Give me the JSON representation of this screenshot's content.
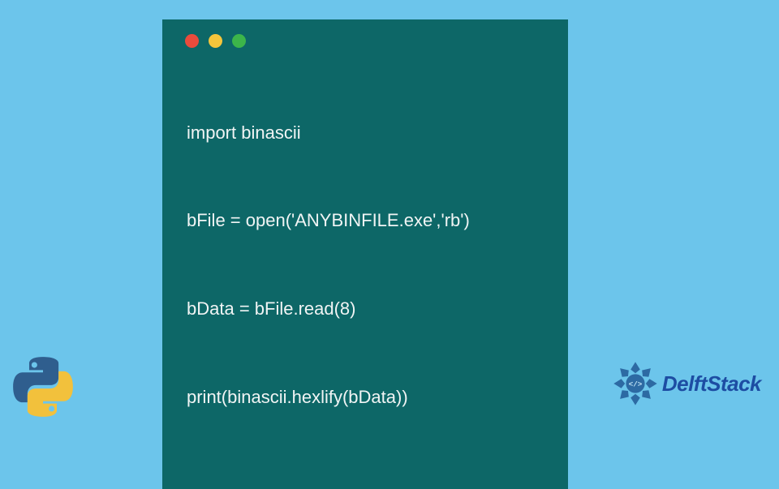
{
  "code": {
    "lines": [
      "import binascii",
      "bFile = open('ANYBINFILE.exe','rb')",
      "bData = bFile.read(8)",
      "print(binascii.hexlify(bData))"
    ]
  },
  "brand": {
    "name": "DelftStack"
  },
  "icons": {
    "python": "python-logo",
    "brand_mark": "delftstack-mandala-icon"
  },
  "colors": {
    "background": "#6cc5eb",
    "window": "#0d6767",
    "code_text": "#f0f4f4",
    "brand_text": "#1d4da3",
    "traffic_red": "#e94b3c",
    "traffic_yellow": "#f5c53b",
    "traffic_green": "#3cb54a"
  }
}
